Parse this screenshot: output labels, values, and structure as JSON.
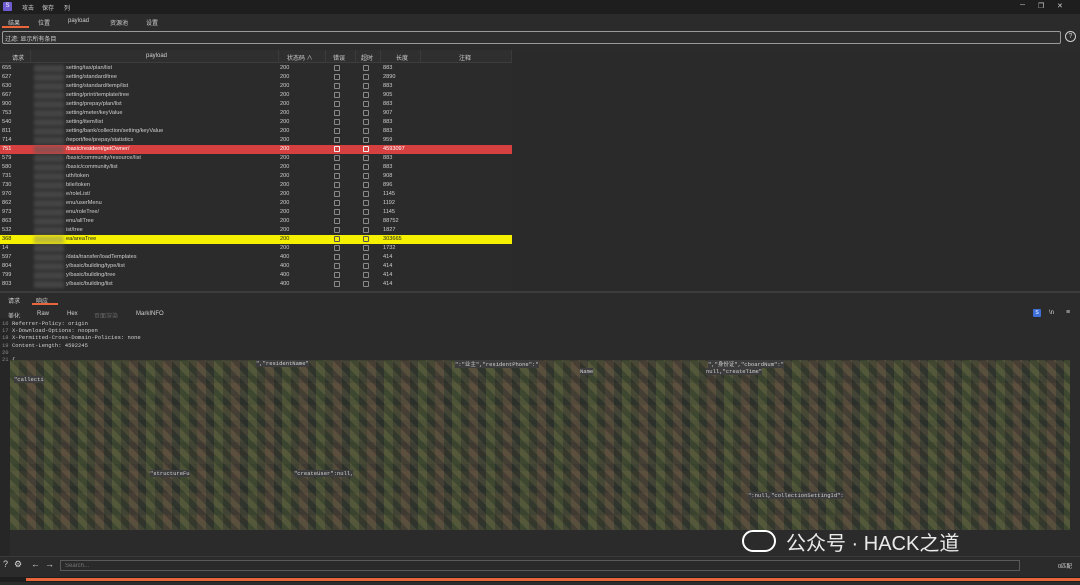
{
  "menu": [
    "攻击",
    "保存",
    "列"
  ],
  "tabs": [
    "结果",
    "位置",
    "payload",
    "资源池",
    "设置"
  ],
  "filter": {
    "text": "过滤: 显示所有条目"
  },
  "table": {
    "headers": [
      "请求",
      "payload",
      "状态码 ∧",
      "错误",
      "超时",
      "长度",
      "注释"
    ],
    "rows": [
      {
        "id": "655",
        "payload": "setting/tax/plan/list",
        "status": "200",
        "length": "883",
        "highlight": ""
      },
      {
        "id": "627",
        "payload": "setting/standard/tree",
        "status": "200",
        "length": "2890",
        "highlight": ""
      },
      {
        "id": "630",
        "payload": "setting/standard/temp/list",
        "status": "200",
        "length": "883",
        "highlight": ""
      },
      {
        "id": "667",
        "payload": "setting/print/template/tree",
        "status": "200",
        "length": "905",
        "highlight": ""
      },
      {
        "id": "900",
        "payload": "setting/prepay/plan/list",
        "status": "200",
        "length": "883",
        "highlight": ""
      },
      {
        "id": "753",
        "payload": "setting/meter/keyValue",
        "status": "200",
        "length": "907",
        "highlight": ""
      },
      {
        "id": "540",
        "payload": "setting/item/list",
        "status": "200",
        "length": "883",
        "highlight": ""
      },
      {
        "id": "811",
        "payload": "setting/bank/collection/setting/keyValue",
        "status": "200",
        "length": "883",
        "highlight": ""
      },
      {
        "id": "714",
        "payload": "/report/fee/prepay/statistics",
        "status": "200",
        "length": "959",
        "highlight": ""
      },
      {
        "id": "751",
        "payload": "/basic/resident/getOwner/",
        "status": "200",
        "length": "4593097",
        "highlight": "red"
      },
      {
        "id": "579",
        "payload": "/basic/community/resource/list",
        "status": "200",
        "length": "883",
        "highlight": ""
      },
      {
        "id": "580",
        "payload": "/basic/community/list",
        "status": "200",
        "length": "883",
        "highlight": ""
      },
      {
        "id": "731",
        "payload": "uth/token",
        "status": "200",
        "length": "908",
        "highlight": ""
      },
      {
        "id": "730",
        "payload": "bile/token",
        "status": "200",
        "length": "896",
        "highlight": ""
      },
      {
        "id": "970",
        "payload": "e/roleList/",
        "status": "200",
        "length": "1145",
        "highlight": ""
      },
      {
        "id": "862",
        "payload": "enu/userMenu",
        "status": "200",
        "length": "1192",
        "highlight": ""
      },
      {
        "id": "973",
        "payload": "enu/roleTree/",
        "status": "200",
        "length": "1145",
        "highlight": ""
      },
      {
        "id": "863",
        "payload": "enu/allTree",
        "status": "200",
        "length": "88752",
        "highlight": ""
      },
      {
        "id": "532",
        "payload": "ist/tree",
        "status": "200",
        "length": "1827",
        "highlight": ""
      },
      {
        "id": "368",
        "payload": "ea/areaTree",
        "status": "200",
        "length": "303665",
        "highlight": "yellow"
      },
      {
        "id": "14",
        "payload": "",
        "status": "200",
        "length": "1732",
        "highlight": ""
      },
      {
        "id": "597",
        "payload": "/data/transfer/loadTemplates",
        "status": "400",
        "length": "414",
        "highlight": ""
      },
      {
        "id": "804",
        "payload": "y/basic/building/type/list",
        "status": "400",
        "length": "414",
        "highlight": ""
      },
      {
        "id": "799",
        "payload": "y/basic/building/tree",
        "status": "400",
        "length": "414",
        "highlight": ""
      },
      {
        "id": "803",
        "payload": "y/basic/building/list",
        "status": "400",
        "length": "414",
        "highlight": ""
      }
    ]
  },
  "lower_tabs": [
    "请求",
    "响应"
  ],
  "view_tabs": [
    "美化",
    "Raw",
    "Hex",
    "页面渲染",
    "MarkINFO"
  ],
  "code_lines": [
    {
      "n": "16",
      "t": "Referrer-Policy: origin"
    },
    {
      "n": "17",
      "t": "X-Download-Options: noopen"
    },
    {
      "n": "18",
      "t": "X-Permitted-Cross-Domain-Policies: none"
    },
    {
      "n": "19",
      "t": "Content-Length: 4592245"
    },
    {
      "n": "20",
      "t": ""
    },
    {
      "n": "21",
      "t": "{"
    }
  ],
  "code_fragments": {
    "f1": "\",\"residentName\"",
    "f2": "\":\"业主\",\"residentPhone\":\"",
    "f3": "\",\"身份证\",\"cboardNum\":\"",
    "f4": "null,\"createTime\"",
    "f5": "Name",
    "f6": "\"structureFu",
    "f7": "\"createUser\":null,",
    "f8": "\":null,\"collectionSettingId\":",
    "f9": "\"callecti"
  },
  "search": {
    "placeholder": "Search..."
  },
  "bottom_right": "0匹配",
  "watermark": "公众号 · HACK之道",
  "colors": {
    "accent": "#e8663a",
    "red_row": "#d64040",
    "yellow_row": "#f4f000"
  }
}
